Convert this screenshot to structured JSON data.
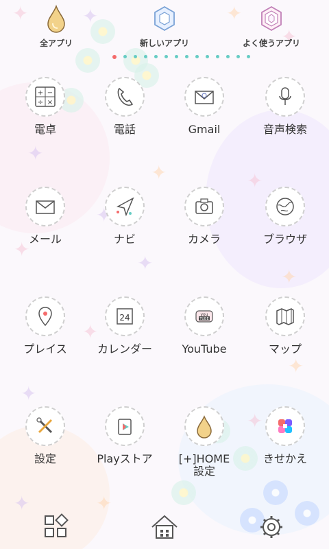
{
  "tabs": [
    {
      "label": "全アプリ"
    },
    {
      "label": "新しいアプリ"
    },
    {
      "label": "よく使うアプリ"
    }
  ],
  "apps": [
    {
      "label": "電卓",
      "icon": "calculator-icon"
    },
    {
      "label": "電話",
      "icon": "phone-icon"
    },
    {
      "label": "Gmail",
      "icon": "mail-envelope-icon"
    },
    {
      "label": "音声検索",
      "icon": "microphone-icon"
    },
    {
      "label": "メール",
      "icon": "envelope-icon"
    },
    {
      "label": "ナビ",
      "icon": "navigation-arrow-icon"
    },
    {
      "label": "カメラ",
      "icon": "camera-icon"
    },
    {
      "label": "ブラウザ",
      "icon": "globe-icon"
    },
    {
      "label": "プレイス",
      "icon": "map-pin-icon"
    },
    {
      "label": "カレンダー",
      "icon": "calendar-icon"
    },
    {
      "label": "YouTube",
      "icon": "youtube-icon"
    },
    {
      "label": "マップ",
      "icon": "folded-map-icon"
    },
    {
      "label": "設定",
      "icon": "tools-icon"
    },
    {
      "label": "Playストア",
      "icon": "play-store-icon"
    },
    {
      "label": "[+]HOME\n設定",
      "icon": "drop-icon"
    },
    {
      "label": "きせかえ",
      "icon": "theme-icon"
    }
  ],
  "dock": {
    "left": "widgets-icon",
    "center": "home-icon",
    "right": "gear-icon"
  },
  "colors": {
    "accent_pink": "#f46b6b",
    "accent_teal": "#66ccc4"
  }
}
